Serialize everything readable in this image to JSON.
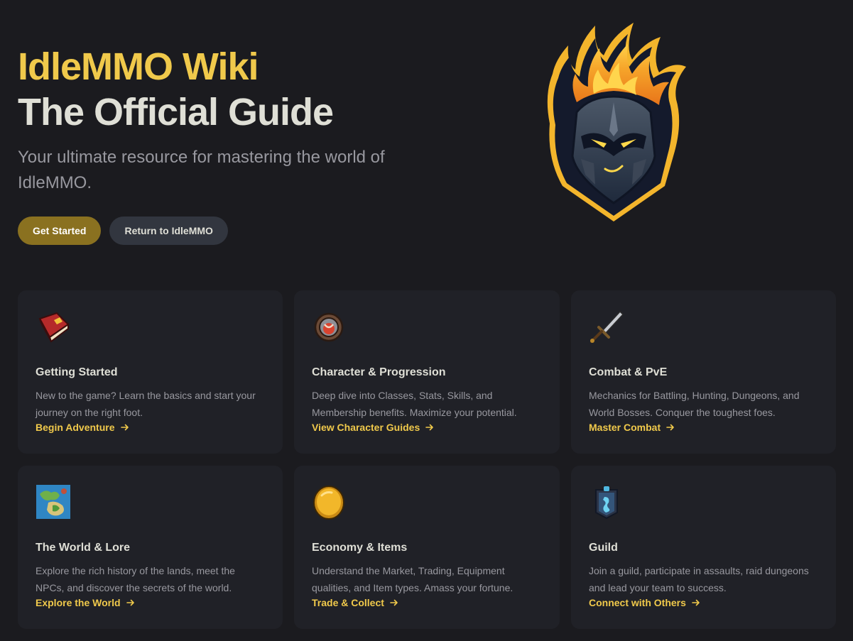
{
  "hero": {
    "name": "IdleMMO Wiki",
    "text": "The Official Guide",
    "tagline": "Your ultimate resource for mastering the world of IdleMMO.",
    "actions": [
      {
        "label": "Get Started",
        "theme": "brand"
      },
      {
        "label": "Return to IdleMMO",
        "theme": "alt"
      }
    ]
  },
  "features": [
    {
      "icon": "red-book-icon",
      "title": "Getting Started",
      "details": "New to the game? Learn the basics and start your journey on the right foot.",
      "link": "Begin Adventure"
    },
    {
      "icon": "amulet-icon",
      "title": "Character & Progression",
      "details": "Deep dive into Classes, Stats, Skills, and Membership benefits. Maximize your potential.",
      "link": "View Character Guides"
    },
    {
      "icon": "sword-icon",
      "title": "Combat & PvE",
      "details": "Mechanics for Battling, Hunting, Dungeons, and World Bosses. Conquer the toughest foes.",
      "link": "Master Combat"
    },
    {
      "icon": "world-map-icon",
      "title": "The World & Lore",
      "details": "Explore the rich history of the lands, meet the NPCs, and discover the secrets of the world.",
      "link": "Explore the World"
    },
    {
      "icon": "gold-coin-icon",
      "title": "Economy & Items",
      "details": "Understand the Market, Trading, Equipment qualities, and Item types. Amass your fortune.",
      "link": "Trade & Collect"
    },
    {
      "icon": "guild-banner-icon",
      "title": "Guild",
      "details": "Join a guild, participate in assaults, raid dungeons and lead your team to success.",
      "link": "Connect with Others"
    }
  ],
  "colors": {
    "background": "#1b1b1f",
    "card": "#202127",
    "brand": "#f0c94b",
    "brand_button": "#8a7120",
    "alt_button": "#32363f",
    "text": "#dfdfd6",
    "muted": "#98989f"
  }
}
